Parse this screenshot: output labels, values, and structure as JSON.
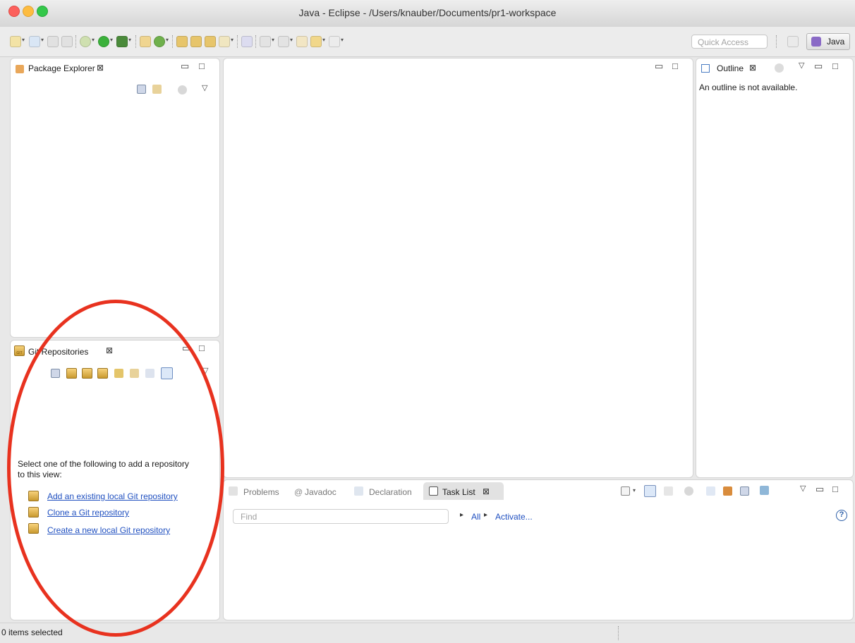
{
  "window": {
    "title": "Java - Eclipse - /Users/knauber/Documents/pr1-workspace"
  },
  "colors": {
    "traffic_close": "#fc605c",
    "traffic_min": "#fdbc40",
    "traffic_max": "#34c84a",
    "link": "#2050c0",
    "annotation_ellipse": "#e8321f"
  },
  "toolbar": {
    "quick_access_placeholder": "Quick Access",
    "perspective_label": "Java"
  },
  "package_explorer": {
    "tab_label": "Package Explorer",
    "close_glyph": "⊠"
  },
  "outline": {
    "tab_label": "Outline",
    "close_glyph": "⊠",
    "message": "An outline is not available."
  },
  "git_repositories": {
    "tab_label": "Git Repositories",
    "close_glyph": "⊠",
    "intro_text": "Select one of the following to add a repository to this view:",
    "links": [
      "Add an existing local Git repository",
      "Clone a Git repository",
      "Create a new local Git repository"
    ]
  },
  "bottom_panel": {
    "tabs": [
      "Problems",
      "Javadoc",
      "Declaration",
      "Task List"
    ],
    "close_glyph": "⊠",
    "at_glyph": "@",
    "find_placeholder": "Find",
    "filter_all": "All",
    "filter_activate": "Activate...",
    "help_glyph": "?"
  },
  "status": {
    "text": "0 items selected"
  },
  "glyphs": {
    "minimize": "▭",
    "maximize": "□",
    "view_menu": "▽",
    "caret": "▾",
    "triangle_right": "▸"
  }
}
